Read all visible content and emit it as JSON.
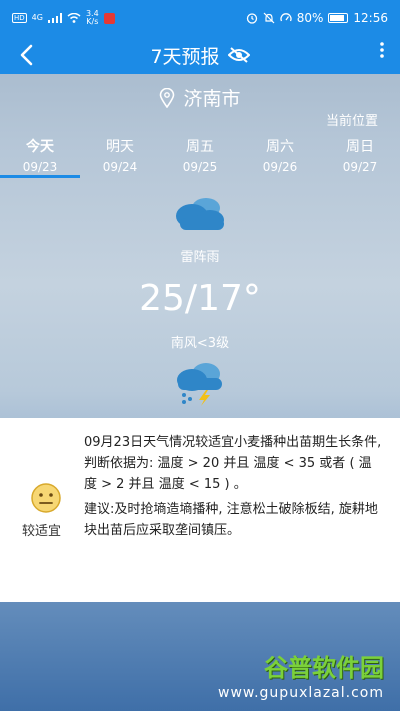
{
  "status_bar": {
    "hd": "HD",
    "signal": "4G",
    "speed_value": "3.4",
    "speed_unit": "K/s",
    "battery": "80%",
    "time": "12:56"
  },
  "app_bar": {
    "title": "7天预报",
    "back_icon": "chevron-left-icon",
    "visibility_icon": "eye-off-icon",
    "more_icon": "more-vertical-icon"
  },
  "location": {
    "city": "济南市",
    "current_position_label": "当前位置"
  },
  "tabs": [
    {
      "day": "今天",
      "date": "09/23",
      "active": true
    },
    {
      "day": "明天",
      "date": "09/24",
      "active": false
    },
    {
      "day": "周五",
      "date": "09/25",
      "active": false
    },
    {
      "day": "周六",
      "date": "09/26",
      "active": false
    },
    {
      "day": "周日",
      "date": "09/27",
      "active": false
    }
  ],
  "weather": {
    "condition": "雷阵雨",
    "temperature": "25/17°",
    "wind": "南风<3级"
  },
  "advice": {
    "rating_label": "较适宜",
    "text": "09月23日天气情况较适宜小麦播种出苗期生长条件,判断依据为: 温度 > 20  并且 温度 < 35  或者 ( 温度 > 2  并且  温度 < 15 ) 。",
    "suggestion": "建议:及时抢墒造墒播种, 注意松土破除板结, 旋耕地块出苗后应采取垄间镇压。"
  },
  "watermark": {
    "logo": "谷普软件园",
    "url": "www.gupuxlazal.com"
  },
  "colors": {
    "accent": "#1c8be6",
    "watermark_green": "#7bd13a"
  }
}
